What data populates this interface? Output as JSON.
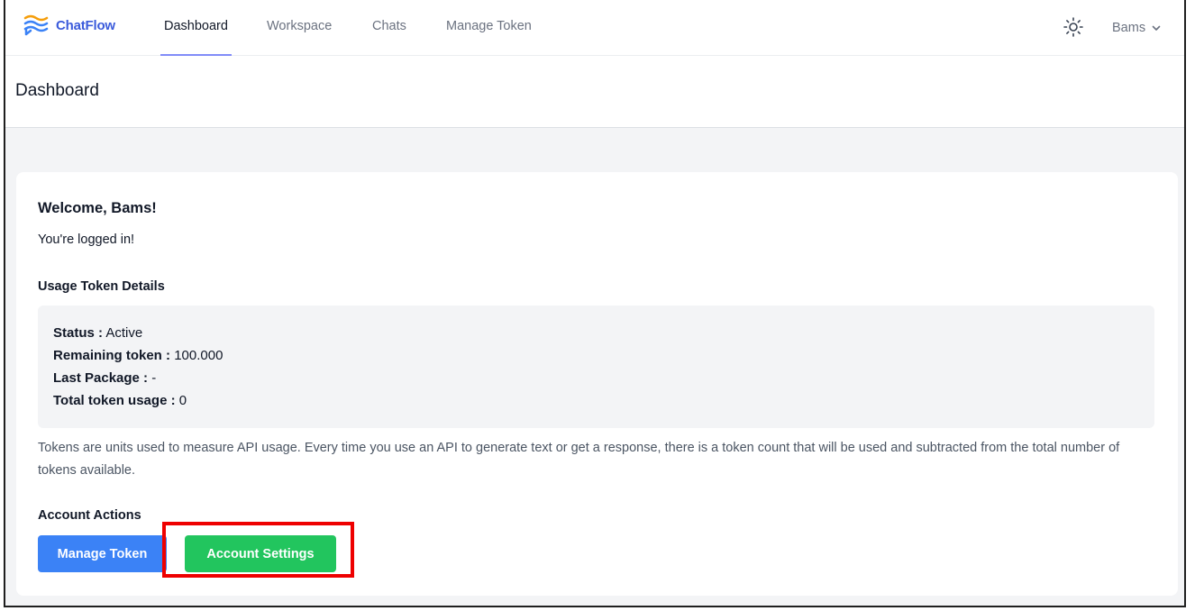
{
  "brand": {
    "name": "ChatFlow",
    "accent": "#3b5bdb",
    "logo_stripes": [
      "#f59e0b",
      "#3b82f6"
    ]
  },
  "nav": {
    "items": [
      {
        "label": "Dashboard",
        "active": true
      },
      {
        "label": "Workspace",
        "active": false
      },
      {
        "label": "Chats",
        "active": false
      },
      {
        "label": "Manage Token",
        "active": false
      }
    ],
    "theme_icon": "sun-icon",
    "user": {
      "name": "Bams",
      "chevron_icon": "chevron-down-icon"
    }
  },
  "header": {
    "title": "Dashboard"
  },
  "welcome": {
    "title": "Welcome, Bams!",
    "subtitle": "You're logged in!"
  },
  "usage": {
    "heading": "Usage Token Details",
    "details": [
      {
        "label": "Status :",
        "value": "Active"
      },
      {
        "label": "Remaining token :",
        "value": "100.000"
      },
      {
        "label": "Last Package :",
        "value": "-"
      },
      {
        "label": "Total token usage :",
        "value": "0"
      }
    ],
    "description": "Tokens are units used to measure API usage. Every time you use an API to generate text or get a response, there is a token count that will be used and subtracted from the total number of tokens available."
  },
  "actions": {
    "heading": "Account Actions",
    "manage_token_label": "Manage Token",
    "account_settings_label": "Account Settings",
    "colors": {
      "manage": "#3b82f6",
      "settings": "#22c55e",
      "highlight": "#ee0000"
    }
  }
}
